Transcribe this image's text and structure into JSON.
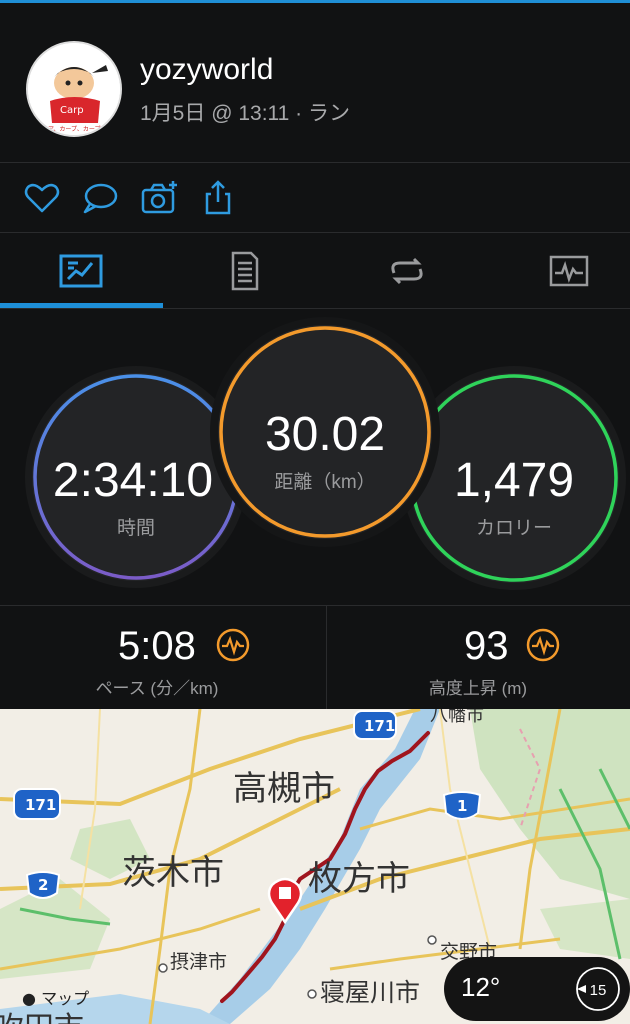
{
  "header": {
    "username": "yozyworld",
    "meta": "1月5日 @ 13:11 · ラン"
  },
  "actions": [
    {
      "icon": "heart-icon"
    },
    {
      "icon": "comment-icon"
    },
    {
      "icon": "camera-add-icon"
    },
    {
      "icon": "share-icon"
    }
  ],
  "tabs": [
    {
      "icon": "overview-icon",
      "active": true
    },
    {
      "icon": "details-list-icon",
      "active": false
    },
    {
      "icon": "laps-icon",
      "active": false
    },
    {
      "icon": "chart-icon",
      "active": false
    }
  ],
  "stats": {
    "time": {
      "value": "2:34:10",
      "label": "時間"
    },
    "distance": {
      "value": "30.02",
      "label": "距離（km）"
    },
    "calories": {
      "value": "1,479",
      "label": "カロリー"
    }
  },
  "metrics": {
    "pace": {
      "value": "5:08",
      "label": "ペース (分／km)"
    },
    "elevation": {
      "value": "93",
      "label": "高度上昇 (m)"
    }
  },
  "map": {
    "labels": {
      "takatsuki": "高槻市",
      "ibaraki": "茨木市",
      "hirakata": "枚方市",
      "settsu": "摂津市",
      "neyagawa": "寝屋川市",
      "katano": "交野市",
      "yawata": "八幡市",
      "partial_city": "吹田市"
    },
    "route_signs": {
      "r171_top": "171",
      "r171_left": "171",
      "r1": "1",
      "r2": "2"
    },
    "attribution": "マップ",
    "weather": {
      "temp": "12°",
      "wind": "15"
    }
  },
  "colors": {
    "accent": "#1e8fd8",
    "time_ring": "#5b8fe8",
    "distance_ring": "#f39a2c",
    "calories_ring": "#2fd35a",
    "route": "#a0151e"
  }
}
